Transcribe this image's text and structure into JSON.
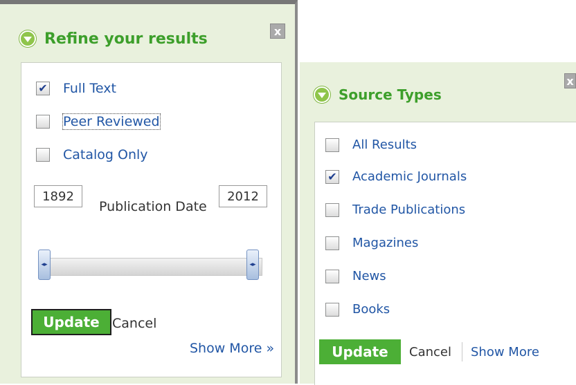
{
  "refine_panel": {
    "title": "Refine your results",
    "close_label": "x",
    "checkboxes": [
      {
        "label": "Full Text",
        "checked": true
      },
      {
        "label": "Peer Reviewed",
        "checked": false
      },
      {
        "label": "Catalog Only",
        "checked": false
      }
    ],
    "date_from": "1892",
    "date_to": "2012",
    "date_label": "Publication Date",
    "slider": {
      "min_value": 1892,
      "max_value": 2012
    },
    "update_label": "Update",
    "cancel_label": "Cancel",
    "show_more_label": "Show More »"
  },
  "source_panel": {
    "title": "Source Types",
    "close_label": "x",
    "checkboxes": [
      {
        "label": "All Results",
        "checked": false
      },
      {
        "label": "Academic Journals",
        "checked": true
      },
      {
        "label": "Trade Publications",
        "checked": false
      },
      {
        "label": "Magazines",
        "checked": false
      },
      {
        "label": "News",
        "checked": false
      },
      {
        "label": "Books",
        "checked": false
      }
    ],
    "update_label": "Update",
    "cancel_label": "Cancel",
    "show_more_label": "Show More"
  },
  "colors": {
    "panel_bg": "#e9f1dd",
    "title_green": "#3d9f2b",
    "button_green": "#4caf36",
    "link_blue": "#2156a5"
  },
  "icons": {
    "toggle": "chevron-down-circle-icon",
    "close": "close-icon",
    "check": "checkmark-icon",
    "slider_handle": "slider-handle-icon"
  }
}
